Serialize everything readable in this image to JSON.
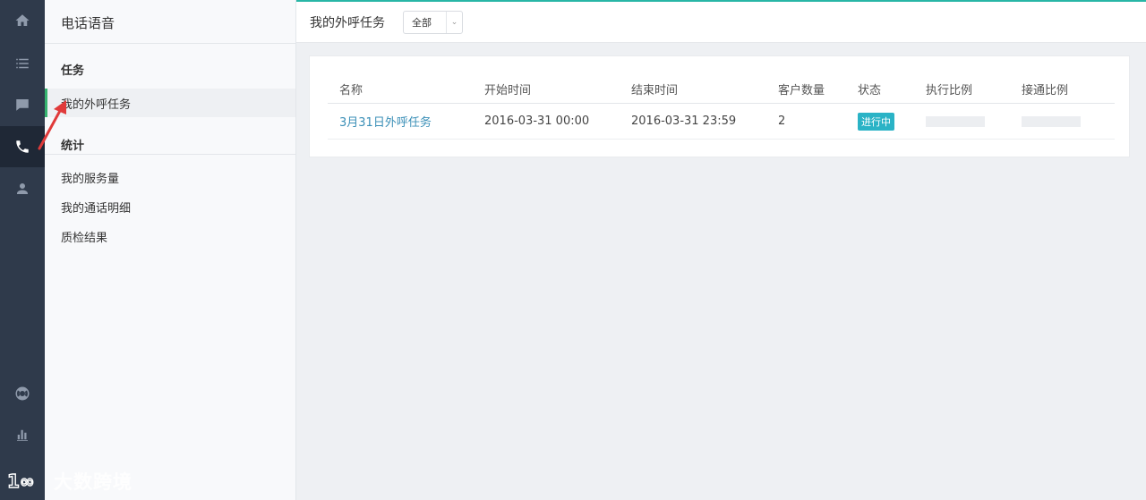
{
  "sidebar": {
    "title": "电话语音",
    "sections": [
      {
        "label": "任务",
        "items": [
          {
            "label": "我的外呼任务",
            "active": true
          }
        ]
      },
      {
        "label": "统计",
        "items": [
          {
            "label": "我的服务量"
          },
          {
            "label": "我的通话明细"
          },
          {
            "label": "质检结果"
          }
        ]
      }
    ]
  },
  "rail": {
    "icons": [
      "home-icon",
      "list-icon",
      "chat-icon",
      "phone-icon",
      "user-icon",
      "lifebuoy-icon",
      "bar-chart-icon"
    ],
    "active": "phone-icon"
  },
  "topbar": {
    "title": "我的外呼任务",
    "filter": {
      "selected": "全部"
    }
  },
  "table": {
    "columns": [
      "名称",
      "开始时间",
      "结束时间",
      "客户数量",
      "状态",
      "执行比例",
      "接通比例"
    ],
    "rows": [
      {
        "name": "3月31日外呼任务",
        "start": "2016-03-31 00:00",
        "end": "2016-03-31 23:59",
        "customers": "2",
        "status": "进行中",
        "exec_ratio": 0,
        "connect_ratio": 0
      }
    ]
  },
  "watermark": {
    "text": "大数跨境"
  },
  "colors": {
    "accent": "#28b6a6",
    "active_indicator": "#35b36f",
    "link": "#3a8fb7",
    "status_badge": "#2ab3c6",
    "rail_bg": "#2f3a4b",
    "annotation_arrow": "#e03a3a"
  }
}
